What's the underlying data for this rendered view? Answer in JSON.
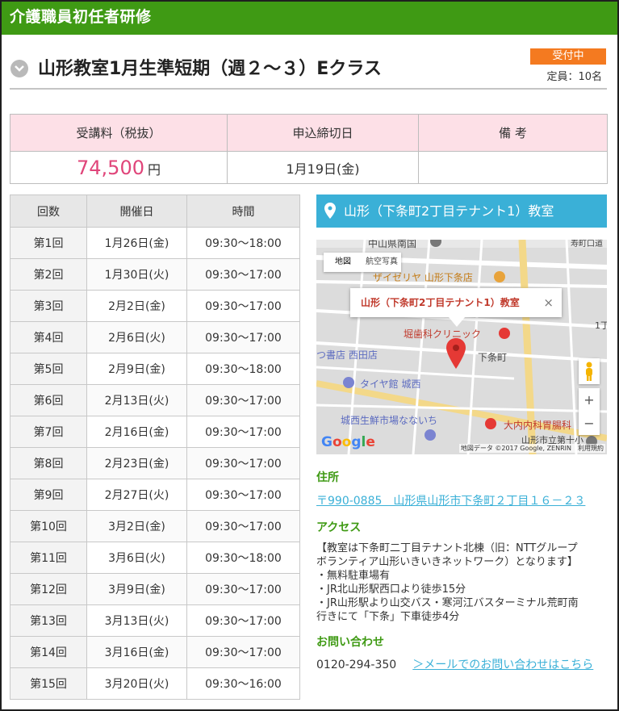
{
  "header": {
    "title": "介護職員初任者研修"
  },
  "course": {
    "title": "山形教室1月生準短期（週２～３）Eクラス",
    "status": "受付中",
    "capacity": "定員：10名"
  },
  "fee_table": {
    "headers": [
      "受講料（税抜）",
      "申込締切日",
      "備 考"
    ],
    "fee": "74,500",
    "fee_unit": "円",
    "deadline": "1月19日(金)",
    "note": ""
  },
  "schedule": {
    "headers": [
      "回数",
      "開催日",
      "時間"
    ],
    "rows": [
      [
        "第1回",
        "1月26日(金)",
        "09:30～18:00"
      ],
      [
        "第2回",
        "1月30日(火)",
        "09:30～17:00"
      ],
      [
        "第3回",
        "2月2日(金)",
        "09:30～17:00"
      ],
      [
        "第4回",
        "2月6日(火)",
        "09:30～17:00"
      ],
      [
        "第5回",
        "2月9日(金)",
        "09:30～18:00"
      ],
      [
        "第6回",
        "2月13日(火)",
        "09:30～17:00"
      ],
      [
        "第7回",
        "2月16日(金)",
        "09:30～17:00"
      ],
      [
        "第8回",
        "2月23日(金)",
        "09:30～17:00"
      ],
      [
        "第9回",
        "2月27日(火)",
        "09:30～17:00"
      ],
      [
        "第10回",
        "3月2日(金)",
        "09:30～17:00"
      ],
      [
        "第11回",
        "3月6日(火)",
        "09:30～18:00"
      ],
      [
        "第12回",
        "3月9日(金)",
        "09:30～17:00"
      ],
      [
        "第13回",
        "3月13日(火)",
        "09:30～17:00"
      ],
      [
        "第14回",
        "3月16日(金)",
        "09:30～17:00"
      ],
      [
        "第15回",
        "3月20日(火)",
        "09:30～16:00"
      ]
    ]
  },
  "venue": {
    "name": "山形（下条町2丁目テナント1）教室"
  },
  "map": {
    "type_map": "地図",
    "type_satellite": "航空写真",
    "popup_title": "山形（下条町2丁目テナント1）教室",
    "labels": {
      "top_cut": "中山県南国",
      "top_right": "寿町口道",
      "daiso": "ザイゼリヤ 山形下条店",
      "clinic": "堀歯科クリニック",
      "shimojo": "下条町",
      "bookstore": "つ書店 西田店",
      "tire": "タイヤ館 城西",
      "market": "城西生鮮市場なないち",
      "hospital": "大内内科胃腸科",
      "school": "山形市立第十小",
      "cho": "1丁"
    },
    "google": "Google",
    "credit": "地図データ ©2017 Google, ZENRIN　利用規約"
  },
  "address": {
    "heading": "住所",
    "text": "〒990-0885　山形県山形市下条町２丁目１６－２３"
  },
  "access": {
    "heading": "アクセス",
    "lines": [
      "【教室は下条町二丁目テナント北棟（旧：NTTグループ",
      "ボランティア山形いきいきネットワーク）となります】",
      "・無料駐車場有",
      "・JR北山形駅西口より徒歩15分",
      "・JR山形駅より山交バス・寒河江バスターミナル荒町南",
      "行きにて「下条」下車徒歩4分"
    ]
  },
  "contact": {
    "heading": "お問い合わせ",
    "phone": "0120-294-350",
    "mail_link": "＞メールでのお問い合わせはこちら"
  },
  "colors": {
    "header_green": "#3f9a14",
    "badge_orange": "#f47a20",
    "venue_blue": "#3ab0d7",
    "fee_pink": "#e0457a",
    "table_pink": "#fde0e7"
  }
}
